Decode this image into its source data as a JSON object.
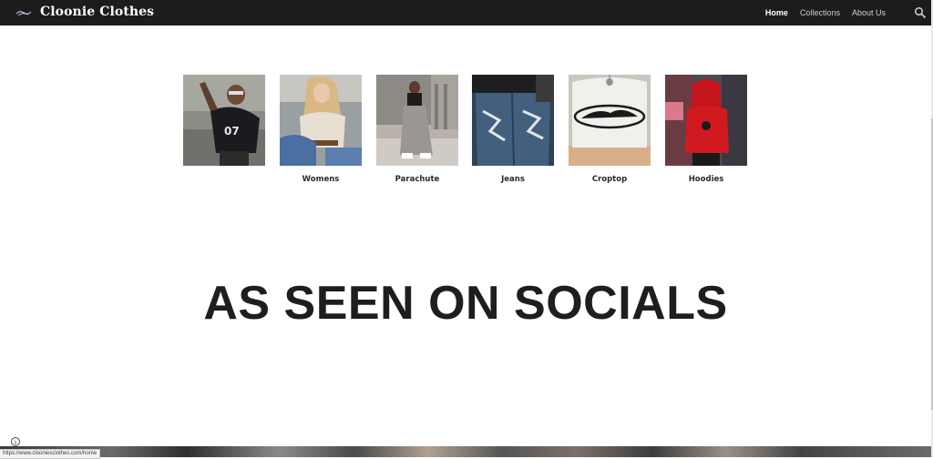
{
  "header": {
    "site_title": "Cloonie Clothes",
    "nav": [
      {
        "label": "Home",
        "active": true
      },
      {
        "label": "Collections",
        "active": false
      },
      {
        "label": "About Us",
        "active": false
      }
    ],
    "search_icon": "search-icon",
    "logo_icon": "brand-logo-icon"
  },
  "collections": [
    {
      "label": "",
      "image": "person-in-jersey-photo"
    },
    {
      "label": "Womens",
      "image": "blonde-woman-photo"
    },
    {
      "label": "Parachute",
      "image": "parachute-pants-photo"
    },
    {
      "label": "Jeans",
      "image": "jeans-photo"
    },
    {
      "label": "Croptop",
      "image": "croptop-photo"
    },
    {
      "label": "Hoodies",
      "image": "red-hoodie-photo"
    }
  ],
  "main": {
    "heading": "AS SEEN ON SOCIALS"
  },
  "status": {
    "url": "https://www.clooniesclothes.com/home",
    "info_icon": "info-icon"
  },
  "colors": {
    "header_bg": "#1c1c1c",
    "heading_text": "#1e1e1e",
    "nav_active": "#ffffff",
    "nav_inactive": "#cfcfcf"
  }
}
